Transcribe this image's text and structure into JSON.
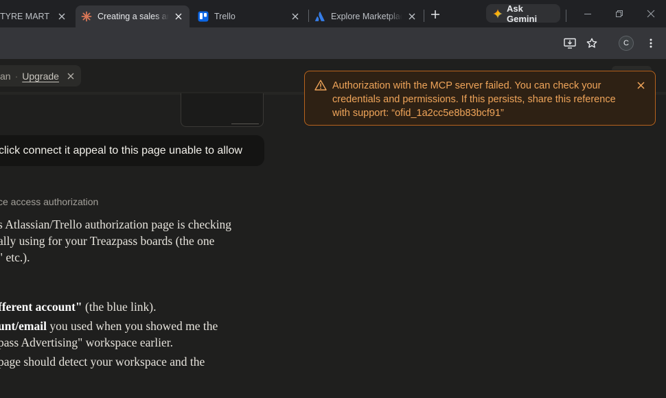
{
  "browser": {
    "tabs": [
      {
        "title": "TYRE MART SD",
        "active": false
      },
      {
        "title": "Creating a sales an",
        "active": true
      },
      {
        "title": "Trello",
        "active": false
      },
      {
        "title": "Explore Marketplac",
        "active": false
      }
    ],
    "ask_gemini_label": "Ask Gemini",
    "profile_initial": "C"
  },
  "page": {
    "plan_partial": "an",
    "plan_separator": "·",
    "upgrade_label": "Upgrade",
    "user_message": "click connect it appeal to this page unable to allow",
    "thinking_label": "ce access authorization",
    "response_lines": [
      "s Atlassian/Trello authorization page is checking",
      "ally using for your Treazpass boards (the one",
      "\" etc.)."
    ],
    "step1_bold": "fferent account\"",
    "step1_rest": " (the blue link).",
    "step2_bold": "unt/email",
    "step2_rest": " you used when you showed me the",
    "step2_line2": "pass Advertising\" workspace earlier.",
    "step3_line1": "page should detect your workspace and the"
  },
  "error_toast": {
    "message": "Authorization with the MCP server failed. You can check your credentials and permissions. If this persists, share this reference with support: “ofid_1a2cc5e8b83bcf91”"
  },
  "colors": {
    "toast_border": "#b8641d",
    "toast_text": "#f0a55a",
    "claude_favicon": "#d97757",
    "trello_blue": "#0c66e4",
    "atlassian_blue": "#357de8"
  }
}
